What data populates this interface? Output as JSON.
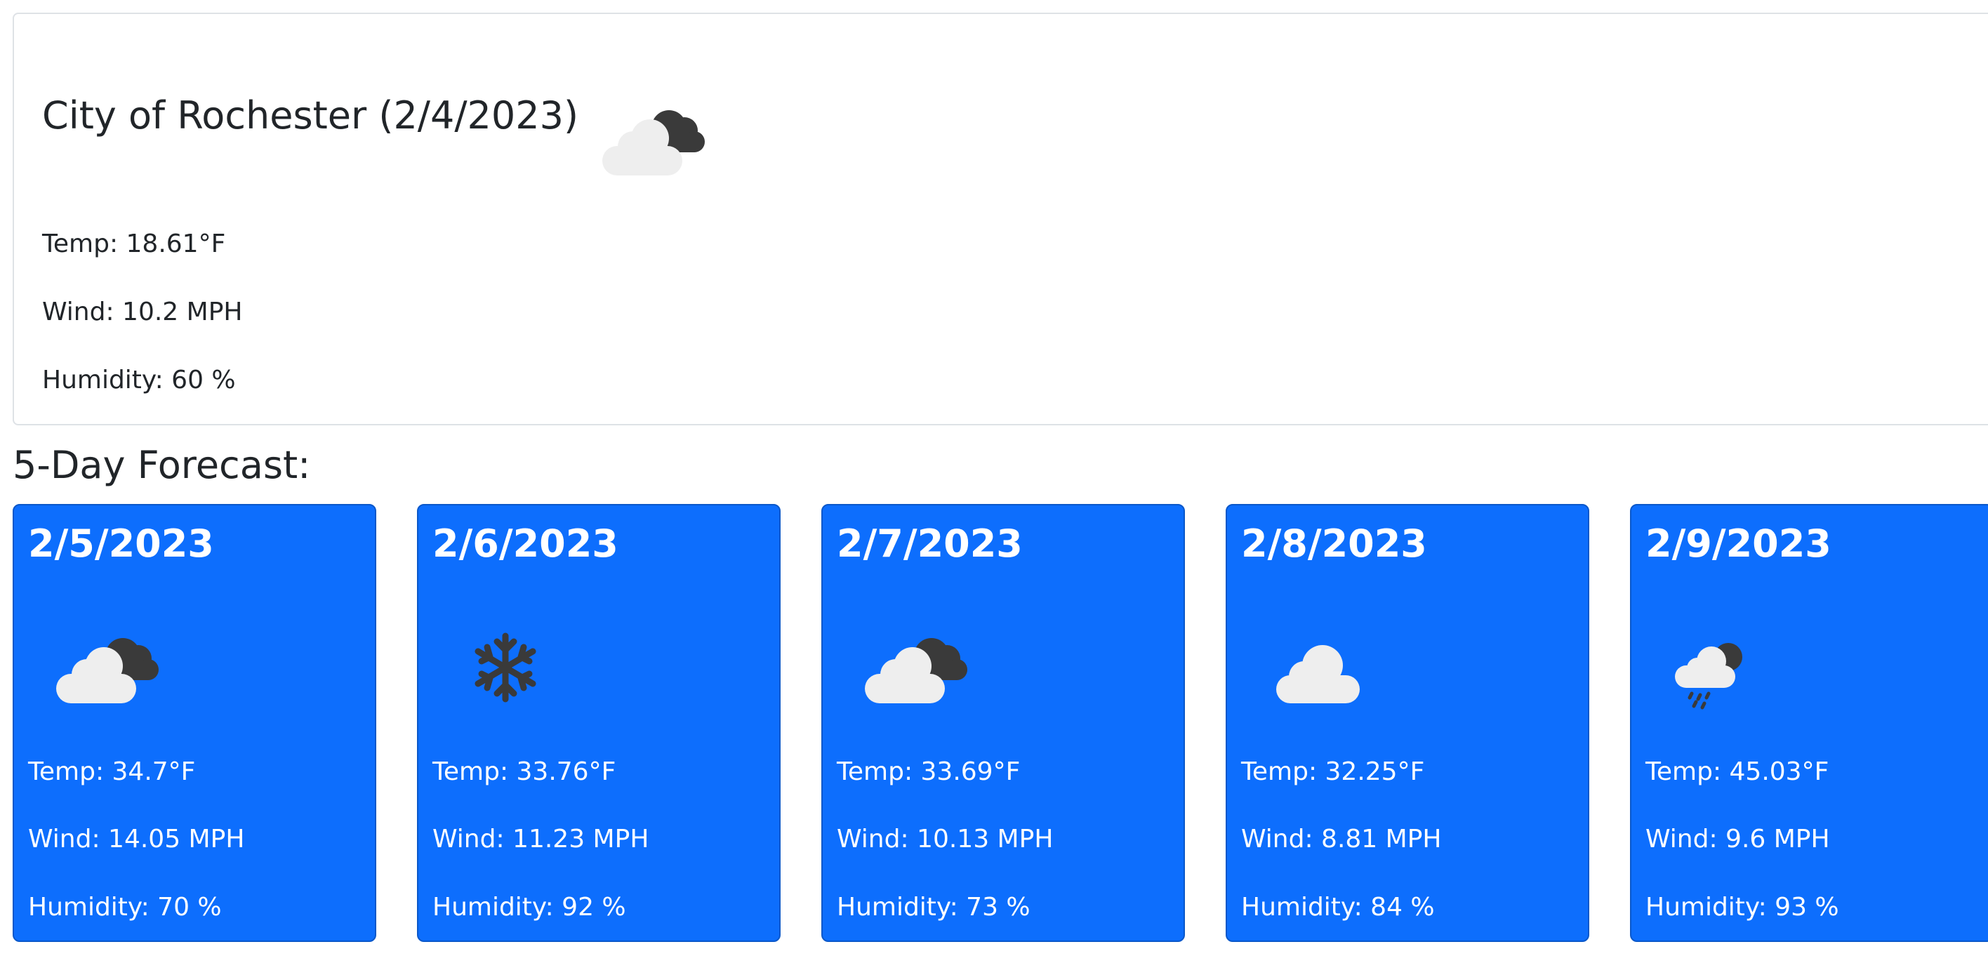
{
  "current": {
    "title": "City of Rochester (2/4/2023)",
    "icon": "cloudy-icon",
    "temp": "Temp: 18.61°F",
    "wind": "Wind: 10.2 MPH",
    "humidity": "Humidity: 60 %"
  },
  "forecast": {
    "heading": "5-Day Forecast:",
    "accent_color": "#0d6efd",
    "days": [
      {
        "date": "2/5/2023",
        "icon": "cloudy-icon",
        "temp": "Temp: 34.7°F",
        "wind": "Wind: 14.05 MPH",
        "humidity": "Humidity: 70 %"
      },
      {
        "date": "2/6/2023",
        "icon": "snowflake-icon",
        "temp": "Temp: 33.76°F",
        "wind": "Wind: 11.23 MPH",
        "humidity": "Humidity: 92 %"
      },
      {
        "date": "2/7/2023",
        "icon": "cloudy-icon",
        "temp": "Temp: 33.69°F",
        "wind": "Wind: 10.13 MPH",
        "humidity": "Humidity: 73 %"
      },
      {
        "date": "2/8/2023",
        "icon": "cloud-icon",
        "temp": "Temp: 32.25°F",
        "wind": "Wind: 8.81 MPH",
        "humidity": "Humidity: 84 %"
      },
      {
        "date": "2/9/2023",
        "icon": "rain-icon",
        "temp": "Temp: 45.03°F",
        "wind": "Wind: 9.6 MPH",
        "humidity": "Humidity: 93 %"
      }
    ]
  }
}
